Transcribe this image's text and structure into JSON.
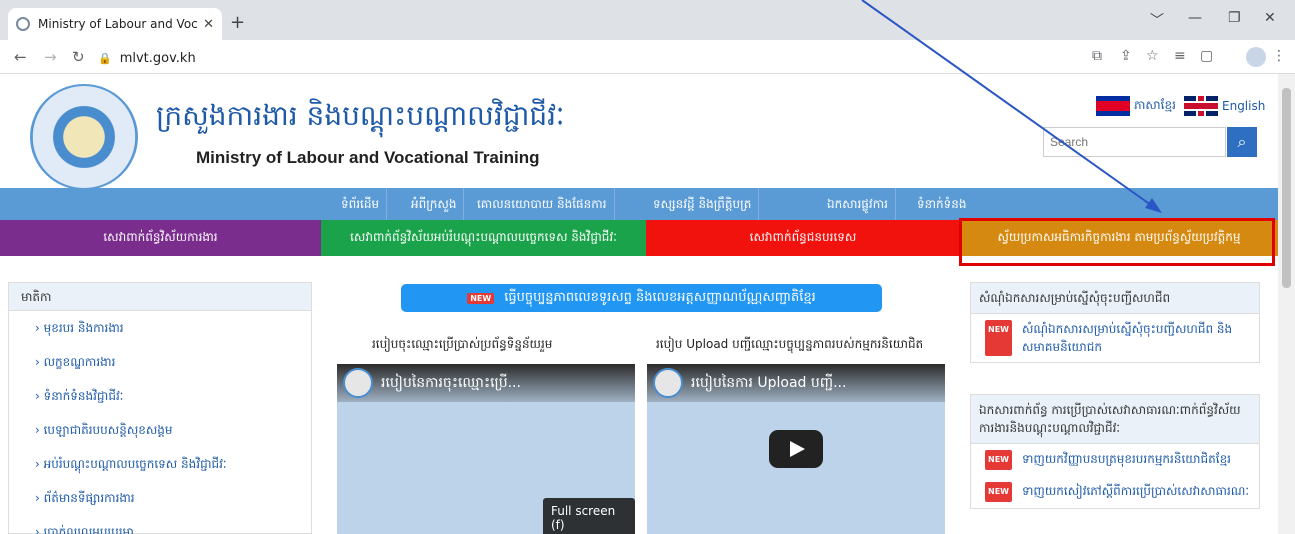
{
  "browser": {
    "tab_title": "Ministry of Labour and Vocational",
    "new_tab": "+",
    "close_tab": "✕",
    "url": "mlvt.gov.kh",
    "window_controls": [
      "﹀",
      "—",
      "❐",
      "✕"
    ]
  },
  "header": {
    "title_km": "ក្រសួងការងារ និងបណ្តុះបណ្តាលវិជ្ជាជីវៈ",
    "title_en": "Ministry of Labour and Vocational Training",
    "lang_km": "ភាសាខ្មែរ",
    "lang_en": "English",
    "search_placeholder": "Search"
  },
  "menu": {
    "items": [
      "ទំព័រដើម",
      "អំពីក្រសួង",
      "គោលនយោបាយ និងផែនការ",
      "ទស្សនវដ្តី និងព្រឹត្តិបត្រ",
      "ឯកសារផ្លូវការ",
      "ទំនាក់ទំនង"
    ]
  },
  "cta": {
    "items": [
      {
        "label": "សេវាពាក់ព័ន្ធវិស័យការងារ",
        "color": "#7b2d8e"
      },
      {
        "label": "សេវាពាក់ព័ន្ធវិស័យអប់រំបណ្តុះបណ្តាលបច្ចេកទេស និងវិជ្ជាជីវៈ",
        "color": "#1aa34a"
      },
      {
        "label": "សេវាពាក់ព័ន្ធជនបរទេស",
        "color": "#f2120d"
      },
      {
        "label": "ស្វ័យប្រកាសអធិការកិច្ចការងារ តាមប្រព័ន្ធស្វ័យប្រវត្តិកម្ម",
        "color": "#d68910"
      }
    ]
  },
  "sidebar": {
    "heading": "មាតិកា",
    "items": [
      "› មុខរបរ និងការងារ",
      "› លក្ខខណ្ឌការងារ",
      "› ទំនាក់ទំនងវិជ្ជាជីវៈ",
      "› បេឡាជាតិរបបសន្តិសុខសង្គម",
      "› អប់រំបណ្តុះបណ្តាលបច្ចេកទេស និងវិជ្ជាជីវៈ",
      "› ព័ត៌មានទីផ្សារការងារ",
      "› ប្រាក់ឈ្នួលអប្បបរមា"
    ]
  },
  "main": {
    "banner_badge": "NEW",
    "banner": "ធ្វើបច្ចុប្បន្នភាពលេខទូរសព្ទ និងលេខអត្តសញ្ញាណប័ណ្ណសញ្ជាតិខ្មែរ",
    "video1_heading": "របៀបចុះឈ្មោះប្រើប្រាស់ប្រព័ន្ធទិន្នន័យរួម",
    "video1_title": "របៀបនៃការចុះឈ្មោះប្រើ...",
    "video1_fullscreen": "Full screen (f)",
    "video2_heading": "របៀប Upload បញ្ជីឈ្មោះបច្ចុប្បន្នភាពរបស់កម្មករនិយោជិត",
    "video2_title": "របៀបនៃការ Upload បញ្ជី..."
  },
  "right": {
    "panel1_heading": "សំណុំឯកសារសម្រាប់ស្នើសុំចុះបញ្ជីសហជីព",
    "panel1_item": "សំណុំឯកសារសម្រាប់ស្នើសុំចុះបញ្ជីសហជីព និងសមាគមនិយោជក",
    "panel2_heading": "ឯកសារពាក់ព័ន្ធ ការប្រើប្រាស់សេវាសាធារណៈពាក់ព័ន្ធវិស័យការងារនិងបណ្តុះបណ្តាលវិជ្ជាជីវៈ",
    "panel2_items": [
      "ទាញយកវិញ្ញាបនបត្រមុខរបរកម្មករនិយោជិតខ្មែរ",
      "ទាញយកសៀវភៅស្តីពីការប្រើប្រាស់សេវាសាធារណៈ"
    ]
  },
  "colors": {
    "menu_bar": "#5b9bd5",
    "highlight_box": "#e00000",
    "annotation_arrow": "#2b57c4"
  }
}
